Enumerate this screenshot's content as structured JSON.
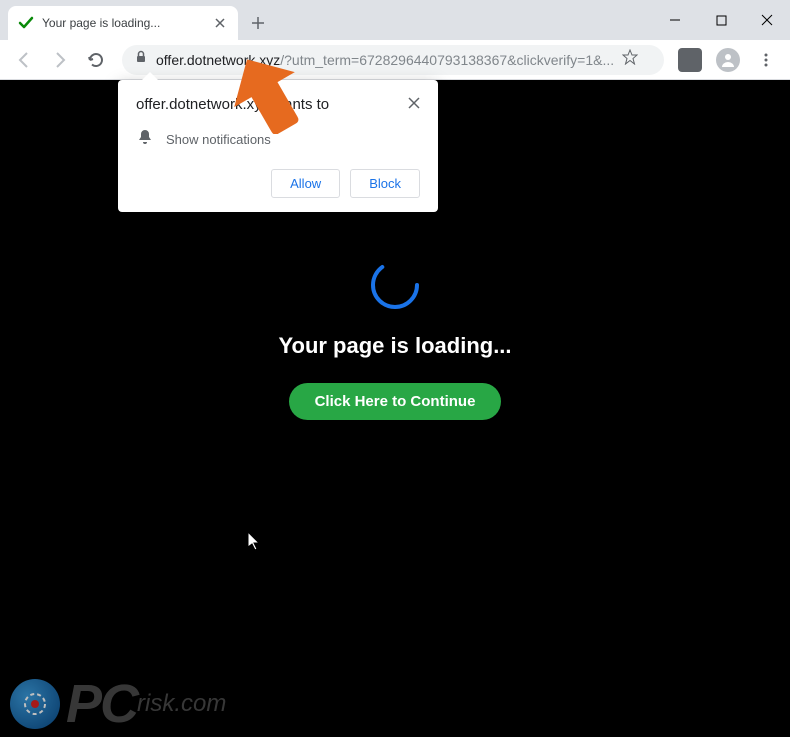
{
  "titlebar": {
    "tab_title": "Your page is loading...",
    "favicon_color": "#0a8a0a"
  },
  "toolbar": {
    "url_domain": "offer.dotnetwork.xyz",
    "url_path": "/?utm_term=6728296440793138367&clickverify=1&..."
  },
  "notification": {
    "title": "offer.dotnetwork.xyz wants to",
    "permission_text": "Show notifications",
    "allow_label": "Allow",
    "block_label": "Block"
  },
  "page": {
    "heading": "Your page is loading...",
    "cta_label": "Click Here to Continue"
  },
  "watermark": {
    "prefix": "PC",
    "suffix": "risk.com"
  },
  "colors": {
    "accent_blue": "#1a73e8",
    "cta_green": "#28a745",
    "arrow": "#e66a1f",
    "spinner": "#1a73e8"
  }
}
